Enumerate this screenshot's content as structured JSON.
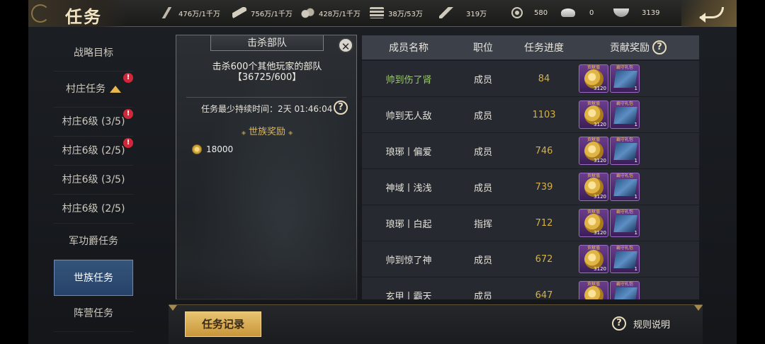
{
  "header": {
    "title": "任务",
    "resources": [
      {
        "icon": "grain-icon",
        "value": "476万/1千万"
      },
      {
        "icon": "wood-icon",
        "value": "756万/1千万"
      },
      {
        "icon": "stone-icon",
        "value": "428万/1千万"
      },
      {
        "icon": "iron-icon",
        "value": "38万/53万"
      },
      {
        "icon": "feather-icon",
        "value": "319万"
      },
      {
        "icon": "copper-coin-icon",
        "value": "580"
      },
      {
        "icon": "gold-ingot-icon",
        "value": "0"
      },
      {
        "icon": "silver-bowl-icon",
        "value": "3139"
      }
    ]
  },
  "sidebar": {
    "items": [
      {
        "label": "战略目标"
      },
      {
        "label": "村庄任务",
        "badge": "!"
      },
      {
        "label": "村庄6级 (3/5)",
        "badge": "!"
      },
      {
        "label": "村庄6级 (2/5)",
        "badge": "!"
      },
      {
        "label": "村庄6级 (3/5)"
      },
      {
        "label": "村庄6级 (2/5)"
      },
      {
        "label": "军功爵任务"
      },
      {
        "label": "世族任务"
      },
      {
        "label": "阵营任务"
      }
    ]
  },
  "mission": {
    "title": "击杀部队",
    "close": "✕",
    "description_line1": "击杀600个其他玩家的部队",
    "description_line2": "【36725/600】",
    "duration": "任务最少持续时间：2天 01:46:04",
    "help": "?",
    "reward_title": "世族奖励",
    "reward_diamond": "◈",
    "reward_amount": "18000"
  },
  "table": {
    "headers": {
      "name": "成员名称",
      "role": "职位",
      "progress": "任务进度",
      "reward": "贡献奖励",
      "help": "?"
    },
    "item_labels": {
      "medal": "贡献值",
      "pack": "霸守礼包"
    },
    "rows": [
      {
        "name": "帅到伤了肾",
        "role": "成员",
        "progress": "84",
        "medal_count": "3120",
        "pack_count": "1"
      },
      {
        "name": "帅到无人敌",
        "role": "成员",
        "progress": "1103",
        "medal_count": "3120",
        "pack_count": "1"
      },
      {
        "name": "琅琊丨偏爱",
        "role": "成员",
        "progress": "746",
        "medal_count": "3120",
        "pack_count": "1"
      },
      {
        "name": "神域丨浅浅",
        "role": "成员",
        "progress": "739",
        "medal_count": "3120",
        "pack_count": "1"
      },
      {
        "name": "琅琊丨白起",
        "role": "指挥",
        "progress": "712",
        "medal_count": "3120",
        "pack_count": "1"
      },
      {
        "name": "帅到惊了神",
        "role": "成员",
        "progress": "672",
        "medal_count": "3120",
        "pack_count": "1"
      },
      {
        "name": "玄甲丨霸天",
        "role": "成员",
        "progress": "647",
        "medal_count": "3120",
        "pack_count": "1"
      }
    ]
  },
  "footer": {
    "records": "任务记录",
    "rules": "规则说明",
    "help": "?"
  },
  "colors": {
    "accent_gold": "#d6b043",
    "active_tab": "#35547a",
    "highlight_green": "#9bc870",
    "badge_red": "#d0283a"
  }
}
